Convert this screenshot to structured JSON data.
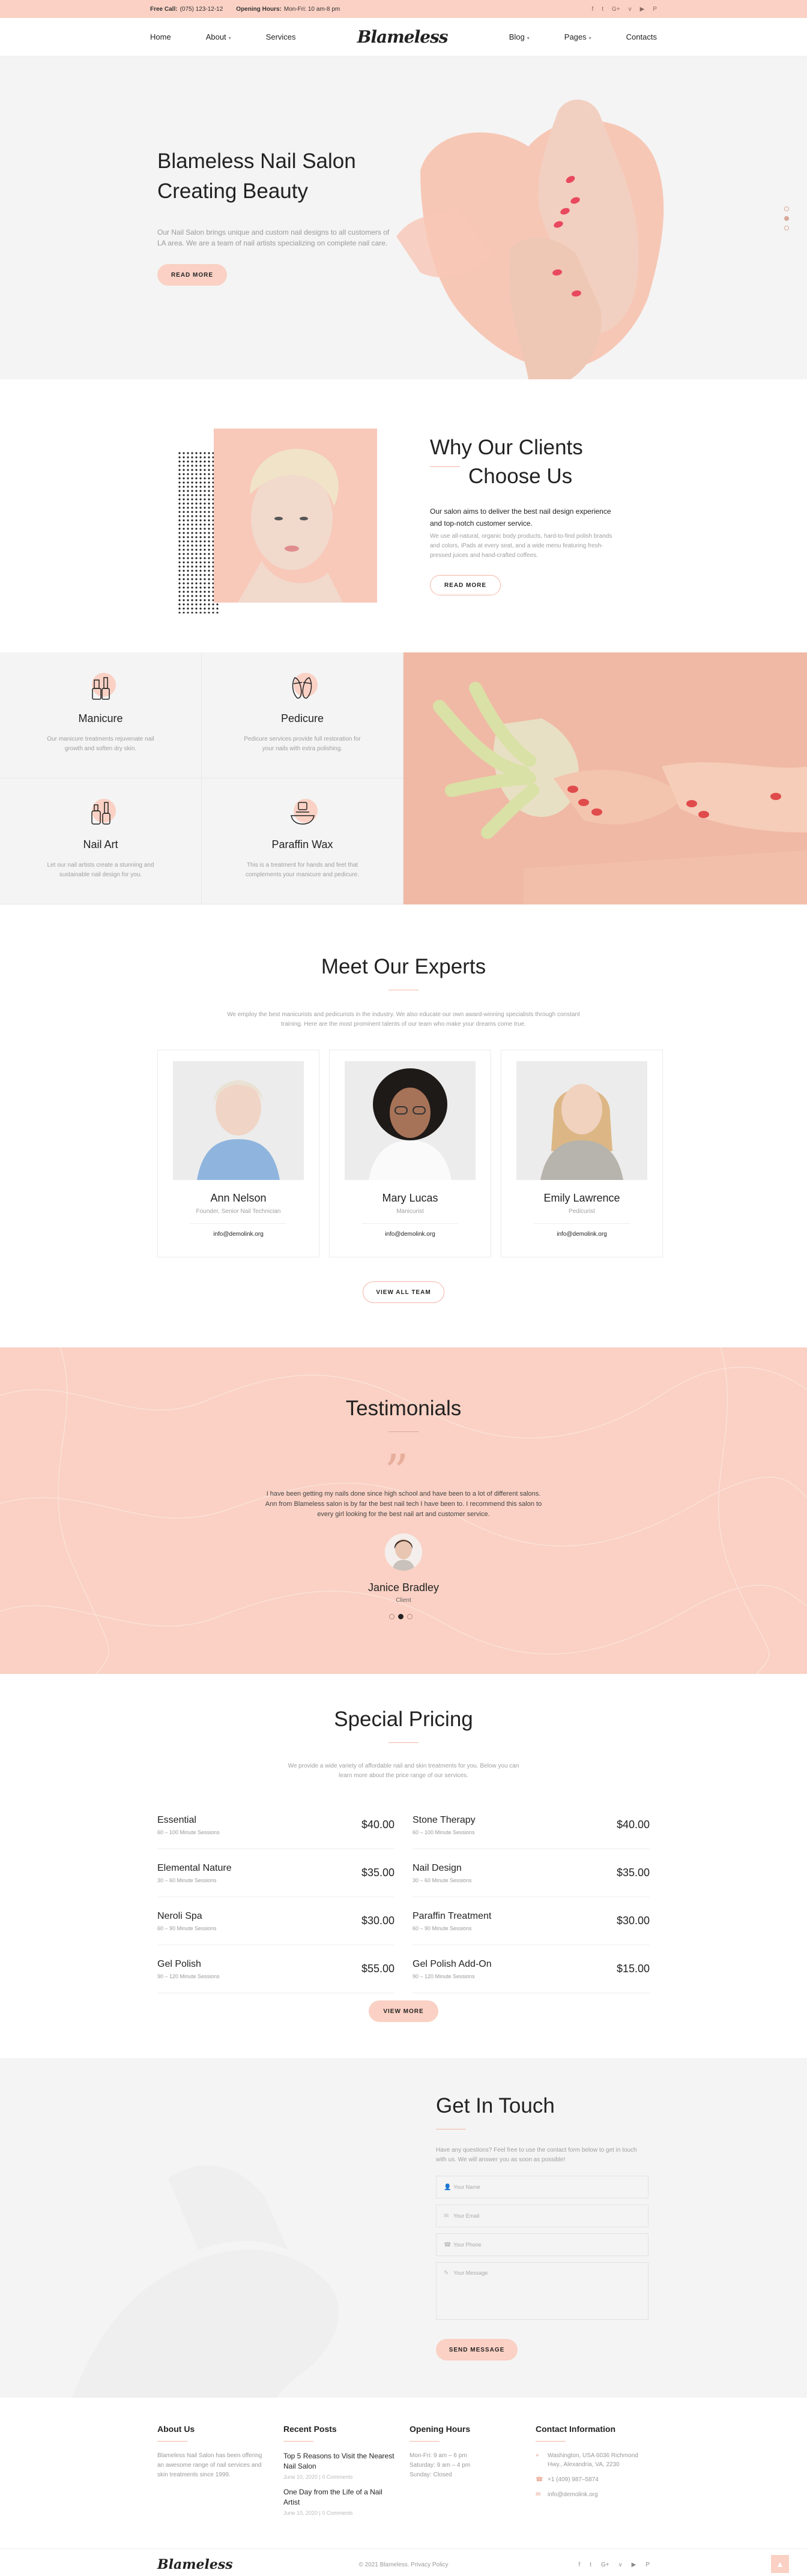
{
  "topbar": {
    "call_label": "Free Call:",
    "call_value": "(075) 123-12-12",
    "hours_label": "Opening Hours:",
    "hours_value": "Mon-Fri: 10 am-8 pm",
    "social": [
      "f",
      "t",
      "G+",
      "v",
      "▶",
      "P"
    ]
  },
  "nav": {
    "left": [
      "Home",
      "About",
      "Services"
    ],
    "logo": "Blameless",
    "right": [
      "Blog",
      "Pages",
      "Contacts"
    ]
  },
  "hero": {
    "title_line1": "Blameless Nail Salon",
    "title_line2": "Creating Beauty",
    "text": "Our Nail Salon brings unique and custom nail designs to all customers of LA area. We are a team of nail artists specializing on complete nail care.",
    "button": "READ MORE"
  },
  "why": {
    "title_line1": "Why Our Clients",
    "title_line2": "Choose Us",
    "lead": "Our salon aims to deliver the best nail design experience and top-notch customer service.",
    "text": "We use all-natural, organic body products, hard-to-find polish brands and colors, iPads at every seat, and a wide menu featuring fresh-pressed juices and hand-crafted coffees.",
    "button": "READ MORE"
  },
  "services": [
    {
      "icon": "nail-polish-icon",
      "title": "Manicure",
      "text": "Our manicure treatments rejuvenate nail growth and soften dry skin."
    },
    {
      "icon": "slippers-icon",
      "title": "Pedicure",
      "text": "Pedicure services provide full restoration for your nails with extra polishing."
    },
    {
      "icon": "nail-bottles-icon",
      "title": "Nail Art",
      "text": "Let our nail artists create a stunning and sustainable nail design for you."
    },
    {
      "icon": "wax-bowl-icon",
      "title": "Paraffin Wax",
      "text": "This is a treatment for hands and feet that complements your manicure and pedicure."
    }
  ],
  "experts": {
    "title": "Meet Our Experts",
    "lead": "We employ the best manicurists and pedicurists in the industry. We also educate our own award-winning specialists through constant training. Here are the most prominent talents of our team who make your dreams come true.",
    "members": [
      {
        "name": "Ann Nelson",
        "role": "Founder, Senior Nail Technician",
        "email": "info@demolink.org"
      },
      {
        "name": "Mary Lucas",
        "role": "Manicurist",
        "email": "info@demolink.org"
      },
      {
        "name": "Emily Lawrence",
        "role": "Pedicurist",
        "email": "info@demolink.org"
      }
    ],
    "button": "VIEW ALL TEAM"
  },
  "testimonials": {
    "title": "Testimonials",
    "text": "I have been getting my nails done since high school and have been to a lot of different salons. Ann from Blameless salon is by far the best nail tech I have been to. I recommend this salon to every girl looking for the best nail art and customer service.",
    "name": "Janice Bradley",
    "role": "Client"
  },
  "pricing": {
    "title": "Special Pricing",
    "lead": "We provide a wide variety of affordable nail and skin treatments for you. Below you can learn more about the price range of our services.",
    "items": [
      {
        "name": "Essential",
        "duration": "60 – 100 Minute Sessions",
        "price": "$40.00"
      },
      {
        "name": "Stone Therapy",
        "duration": "60 – 100 Minute Sessions",
        "price": "$40.00"
      },
      {
        "name": "Elemental Nature",
        "duration": "30 – 60 Minute Sessions",
        "price": "$35.00"
      },
      {
        "name": "Nail Design",
        "duration": "30 – 60 Minute Sessions",
        "price": "$35.00"
      },
      {
        "name": "Neroli Spa",
        "duration": "60 – 90 Minute Sessions",
        "price": "$30.00"
      },
      {
        "name": "Paraffin Treatment",
        "duration": "60 – 90 Minute Sessions",
        "price": "$30.00"
      },
      {
        "name": "Gel Polish",
        "duration": "90 – 120 Minute Sessions",
        "price": "$55.00"
      },
      {
        "name": "Gel Polish Add-On",
        "duration": "90 – 120 Minute Sessions",
        "price": "$15.00"
      }
    ],
    "button": "VIEW MORE"
  },
  "contact": {
    "title": "Get In Touch",
    "lead": "Have any questions? Feel free to use the contact form below to get in touch with us. We will answer you as soon as possible!",
    "name_placeholder": "Your Name",
    "email_placeholder": "Your Email",
    "phone_placeholder": "Your Phone",
    "message_placeholder": "Your Message",
    "button": "SEND MESSAGE"
  },
  "footer": {
    "about_title": "About Us",
    "about_text": "Blameless Nail Salon has been offering an awesome range of nail services and skin treatments since 1999.",
    "posts_title": "Recent Posts",
    "posts": [
      {
        "title": "Top 5 Reasons to Visit the Nearest Nail Salon",
        "meta": "June 10, 2020 | 0 Comments"
      },
      {
        "title": "One Day from the Life of a Nail Artist",
        "meta": "June 10, 2020 | 0 Comments"
      }
    ],
    "hours_title": "Opening Hours",
    "hours": [
      "Mon-Fri: 9 am – 6 pm",
      "Saturday: 9 am – 4 pm",
      "Sunday: Closed"
    ],
    "contact_title": "Contact Information",
    "address": "Washington, USA 6036 Richmond Hwy., Alexandria, VA, 2230",
    "phone": "+1 (409) 987–5874",
    "email": "info@demolink.org",
    "logo": "Blameless",
    "copyright": "© 2021 Blameless. Privacy Policy",
    "social": [
      "f",
      "t",
      "G+",
      "v",
      "▶",
      "P"
    ]
  },
  "colors": {
    "accent": "#fad1c4",
    "accent_dark": "#e8a591",
    "text": "#222222",
    "muted": "#a0a0a0"
  }
}
